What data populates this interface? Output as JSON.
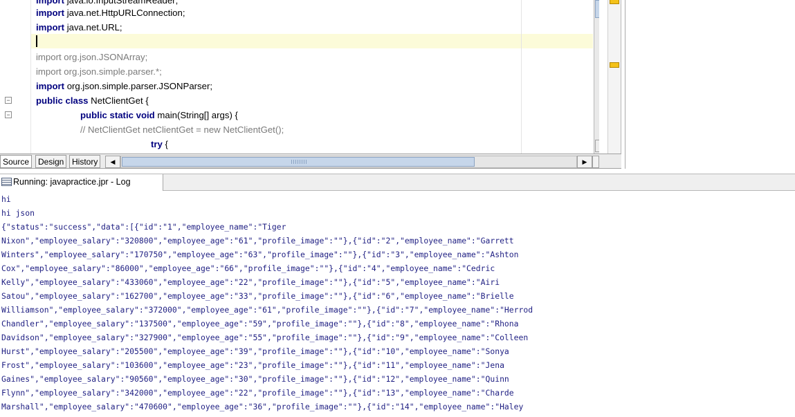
{
  "editor": {
    "lines": [
      {
        "kw": "import",
        "rest": " java.io.InputStreamReader;",
        "style": "normal"
      },
      {
        "kw": "import",
        "rest": " java.net.HttpURLConnection;",
        "style": "normal"
      },
      {
        "kw": "import",
        "rest": " java.net.URL;",
        "style": "normal"
      },
      {
        "kw": "",
        "rest": "",
        "style": "normal"
      },
      {
        "kw": "import",
        "rest": " org.json.JSONArray;",
        "style": "dim"
      },
      {
        "kw": "import",
        "rest": " org.json.simple.parser.*;",
        "style": "dim"
      },
      {
        "kw": "import",
        "rest": " org.json.simple.parser.JSONParser;",
        "style": "normal"
      },
      {
        "kw": "public class",
        "rest": " NetClientGet {",
        "style": "normal"
      },
      {
        "kw": "public static void",
        "rest": " main(String[] args) {",
        "style": "normal"
      },
      {
        "kw": "",
        "rest": "// NetClientGet netClientGet = new NetClientGet();",
        "style": "comment"
      },
      {
        "kw": "try",
        "rest": " {",
        "style": "normal"
      }
    ],
    "tabs": [
      "Source",
      "Design",
      "History"
    ],
    "active_tab": "Source"
  },
  "log": {
    "tab_label": "Running: javapractice.jpr - Log",
    "lines": [
      "hi",
      "hi json",
      "{\"status\":\"success\",\"data\":[{\"id\":\"1\",\"employee_name\":\"Tiger",
      "Nixon\",\"employee_salary\":\"320800\",\"employee_age\":\"61\",\"profile_image\":\"\"},{\"id\":\"2\",\"employee_name\":\"Garrett",
      "Winters\",\"employee_salary\":\"170750\",\"employee_age\":\"63\",\"profile_image\":\"\"},{\"id\":\"3\",\"employee_name\":\"Ashton",
      "Cox\",\"employee_salary\":\"86000\",\"employee_age\":\"66\",\"profile_image\":\"\"},{\"id\":\"4\",\"employee_name\":\"Cedric",
      "Kelly\",\"employee_salary\":\"433060\",\"employee_age\":\"22\",\"profile_image\":\"\"},{\"id\":\"5\",\"employee_name\":\"Airi",
      "Satou\",\"employee_salary\":\"162700\",\"employee_age\":\"33\",\"profile_image\":\"\"},{\"id\":\"6\",\"employee_name\":\"Brielle",
      "Williamson\",\"employee_salary\":\"372000\",\"employee_age\":\"61\",\"profile_image\":\"\"},{\"id\":\"7\",\"employee_name\":\"Herrod",
      "Chandler\",\"employee_salary\":\"137500\",\"employee_age\":\"59\",\"profile_image\":\"\"},{\"id\":\"8\",\"employee_name\":\"Rhona",
      "Davidson\",\"employee_salary\":\"327900\",\"employee_age\":\"55\",\"profile_image\":\"\"},{\"id\":\"9\",\"employee_name\":\"Colleen",
      "Hurst\",\"employee_salary\":\"205500\",\"employee_age\":\"39\",\"profile_image\":\"\"},{\"id\":\"10\",\"employee_name\":\"Sonya",
      "Frost\",\"employee_salary\":\"103600\",\"employee_age\":\"23\",\"profile_image\":\"\"},{\"id\":\"11\",\"employee_name\":\"Jena",
      "Gaines\",\"employee_salary\":\"90560\",\"employee_age\":\"30\",\"profile_image\":\"\"},{\"id\":\"12\",\"employee_name\":\"Quinn",
      "Flynn\",\"employee_salary\":\"342000\",\"employee_age\":\"22\",\"profile_image\":\"\"},{\"id\":\"13\",\"employee_name\":\"Charde",
      "Marshall\",\"employee_salary\":\"470600\",\"employee_age\":\"36\",\"profile_image\":\"\"},{\"id\":\"14\",\"employee_name\":\"Haley"
    ]
  },
  "colors": {
    "keyword": "#00007f",
    "log_text": "#1e1e82",
    "current_line": "#fcfbd9",
    "warning_marker": "#f4c21a"
  }
}
